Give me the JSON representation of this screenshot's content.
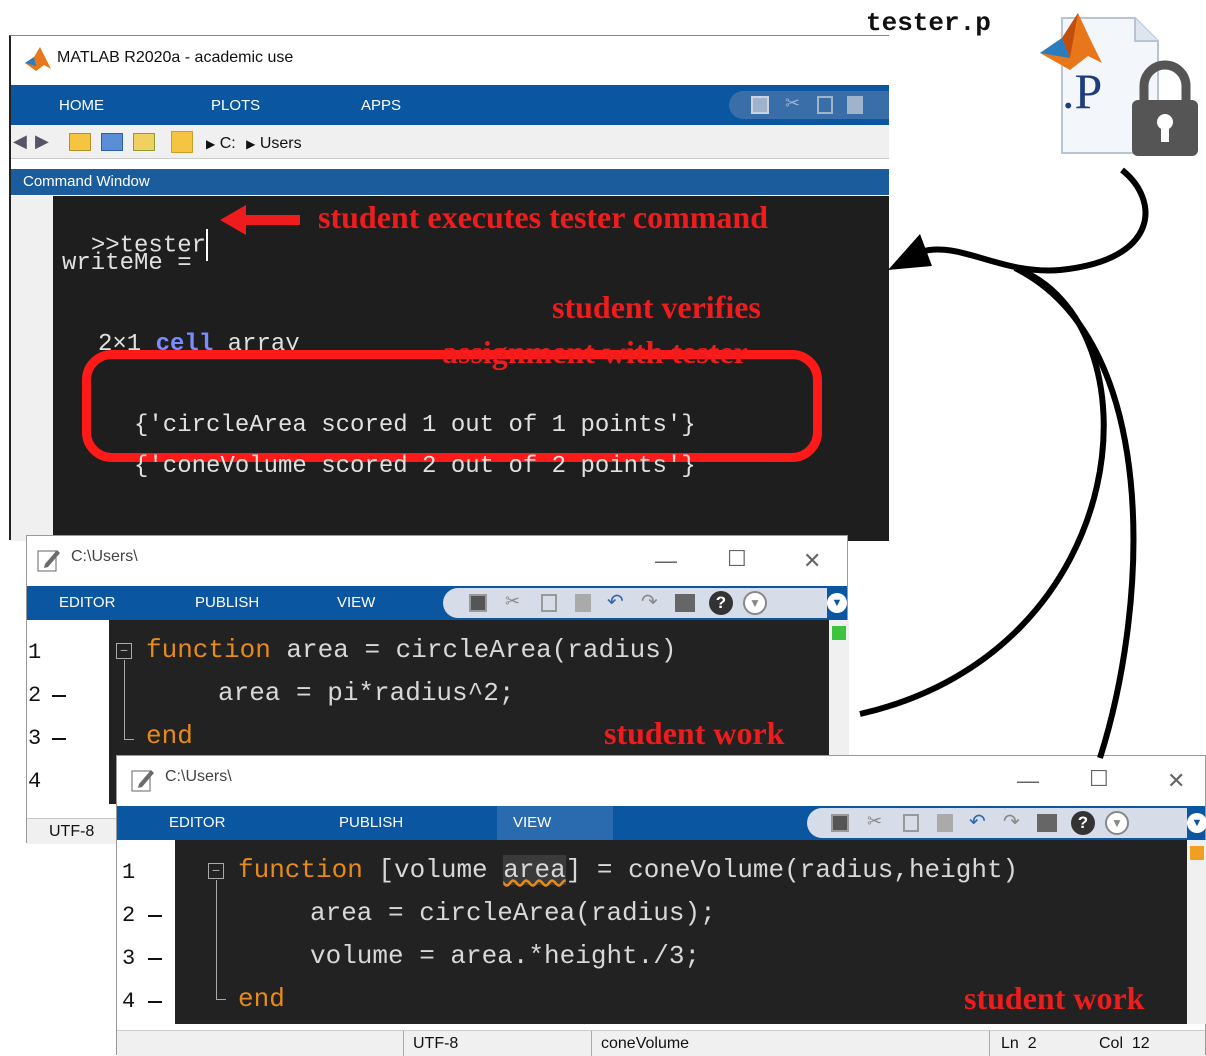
{
  "pfile": {
    "label": "tester.p",
    "icon_text": ".P"
  },
  "main": {
    "title": "MATLAB R2020a - academic use",
    "tabs": [
      "HOME",
      "PLOTS",
      "APPS"
    ],
    "path": [
      "C:",
      "Users"
    ],
    "command_window_title": "Command Window",
    "lines": {
      "prompt": ">>tester",
      "writeme": "writeMe =",
      "size_text": "2×1",
      "cell_link": "cell",
      "array_text": "array",
      "result1": "{'circleArea scored 1 out of 1 points'}",
      "result2": "{'coneVolume scored 2 out of 2 points'}"
    }
  },
  "annotations": {
    "executes": "student executes tester command",
    "verifies_1": "student verifies",
    "verifies_2": "assignment with tester",
    "student_work_1": "student work",
    "student_work_2": "student work"
  },
  "editor1": {
    "title": "C:\\Users\\",
    "tabs": [
      "EDITOR",
      "PUBLISH",
      "VIEW"
    ],
    "line_numbers": [
      "1",
      "2",
      "3",
      "4"
    ],
    "code": {
      "l1_kw": "function",
      "l1_rest": " area = circleArea(radius)",
      "l2": "area = pi*radius^2;",
      "l3_kw": "end"
    },
    "status": {
      "encoding": "UTF-8"
    }
  },
  "editor2": {
    "title": "C:\\Users\\",
    "tabs": [
      "EDITOR",
      "PUBLISH",
      "VIEW"
    ],
    "line_numbers": [
      "1",
      "2",
      "3",
      "4"
    ],
    "code": {
      "l1_kw": "function",
      "l1_a": " [volume ",
      "l1_area": "area",
      "l1_b": "] = coneVolume(radius,height)",
      "l2": "area = circleArea(radius);",
      "l3": "volume = area.*height./3;",
      "l4_kw": "end"
    },
    "status": {
      "encoding": "UTF-8",
      "function": "coneVolume",
      "ln": "Ln  2",
      "col": "Col  12"
    }
  },
  "colors": {
    "accent_red": "#ee1c1c",
    "ribbon_blue": "#0b56a0",
    "keyword_orange": "#e88a1a"
  }
}
